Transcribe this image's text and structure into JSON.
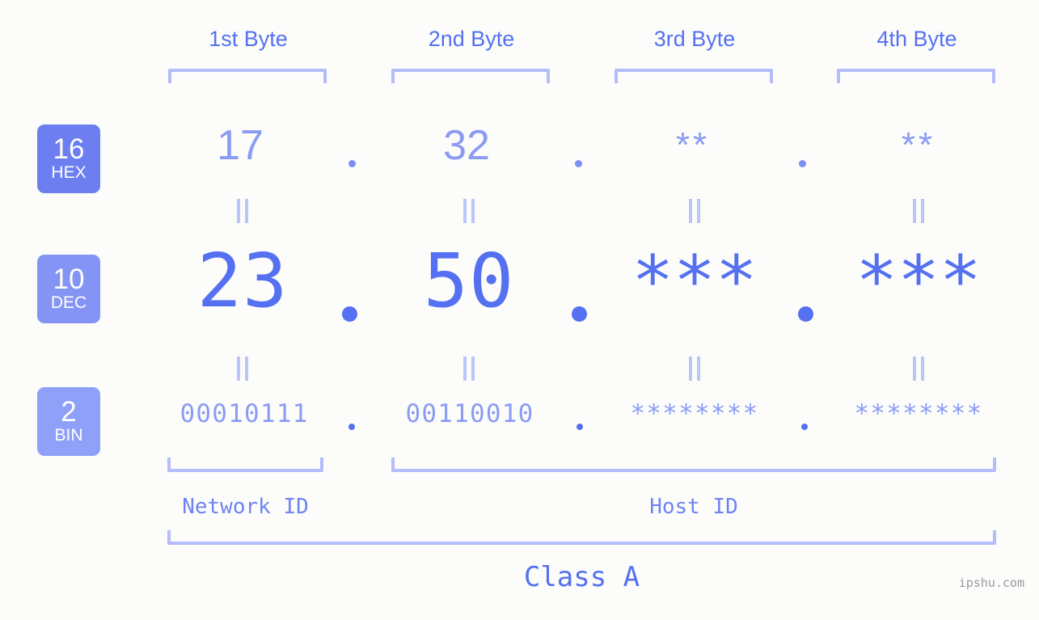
{
  "background_color": "#fcfdfa",
  "accent_color": "#5570f1",
  "accent_light": "#8b9bf3",
  "bracket_color": "#b4bdf9",
  "headers": {
    "byte1": "1st Byte",
    "byte2": "2nd Byte",
    "byte3": "3rd Byte",
    "byte4": "4th Byte"
  },
  "bases": [
    {
      "number": "16",
      "label": "HEX",
      "color": "#6c7ef0"
    },
    {
      "number": "10",
      "label": "DEC",
      "color": "#8494f4"
    },
    {
      "number": "2",
      "label": "BIN",
      "color": "#8fa0f8"
    }
  ],
  "rows": {
    "hex": {
      "base_number": "16",
      "base_label": "HEX",
      "values": [
        "17",
        "32",
        "**",
        "**"
      ]
    },
    "dec": {
      "base_number": "10",
      "base_label": "DEC",
      "values": [
        "23",
        "50",
        "***",
        "***"
      ]
    },
    "bin": {
      "base_number": "2",
      "base_label": "BIN",
      "values": [
        "00010111",
        "00110010",
        "********",
        "********"
      ]
    }
  },
  "separators": {
    "dot": ".",
    "equals": "||"
  },
  "footer": {
    "network_id": "Network ID",
    "host_id": "Host ID",
    "class": "Class A",
    "watermark": "ipshu.com"
  }
}
